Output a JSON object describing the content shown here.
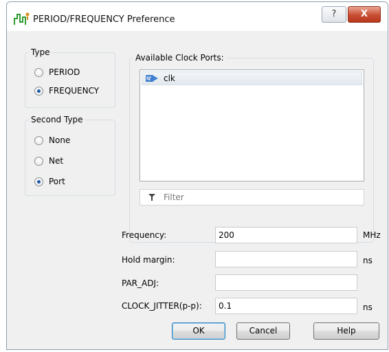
{
  "window": {
    "title": "PERIOD/FREQUENCY Preference",
    "help_button": "?",
    "close_button": "X"
  },
  "type_group": {
    "legend": "Type",
    "options": [
      {
        "label": "PERIOD",
        "selected": false
      },
      {
        "label": "FREQUENCY",
        "selected": true
      }
    ]
  },
  "second_type_group": {
    "legend": "Second Type",
    "options": [
      {
        "label": "None",
        "selected": false
      },
      {
        "label": "Net",
        "selected": false
      },
      {
        "label": "Port",
        "selected": true
      }
    ]
  },
  "clock_ports": {
    "legend": "Available Clock Ports:",
    "items": [
      "clk"
    ],
    "filter_placeholder": "Filter"
  },
  "fields": {
    "frequency": {
      "label": "Frequency:",
      "value": "200",
      "unit": "MHz"
    },
    "hold_margin": {
      "label": "Hold margin:",
      "value": "",
      "unit": "ns"
    },
    "par_adj": {
      "label": "PAR_ADJ:",
      "value": ""
    },
    "clock_jitter": {
      "label": "CLOCK_JITTER(p-p):",
      "value": "0.1",
      "unit": "ns"
    }
  },
  "buttons": {
    "ok": "OK",
    "cancel": "Cancel",
    "help": "Help"
  }
}
